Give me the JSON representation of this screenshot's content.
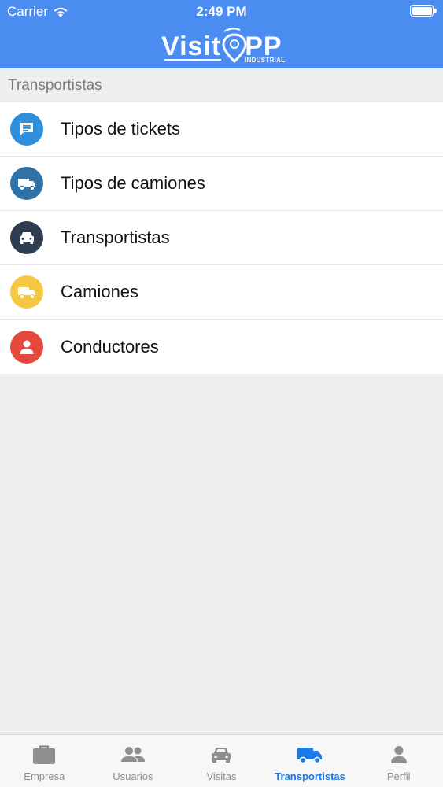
{
  "status_bar": {
    "carrier": "Carrier",
    "time": "2:49 PM"
  },
  "header": {
    "logo_text": "VisitOPP",
    "logo_subtitle": "INDUSTRIAL",
    "background_color": "#4a8cf0"
  },
  "section": {
    "title": "Transportistas"
  },
  "menu": {
    "items": [
      {
        "label": "Tipos de tickets",
        "icon": "message-icon",
        "color": "#2f8fdc"
      },
      {
        "label": "Tipos de camiones",
        "icon": "truck-icon",
        "color": "#2f72a8"
      },
      {
        "label": "Transportistas",
        "icon": "car-icon",
        "color": "#2e3d4f"
      },
      {
        "label": "Camiones",
        "icon": "truck-icon",
        "color": "#f5c842"
      },
      {
        "label": "Conductores",
        "icon": "person-icon",
        "color": "#e5483c"
      }
    ]
  },
  "tabbar": {
    "tabs": [
      {
        "label": "Empresa",
        "icon": "briefcase-icon"
      },
      {
        "label": "Usuarios",
        "icon": "users-icon"
      },
      {
        "label": "Visitas",
        "icon": "car-icon"
      },
      {
        "label": "Transportistas",
        "icon": "truck-icon",
        "active": true
      },
      {
        "label": "Perfil",
        "icon": "person-icon"
      }
    ],
    "active_color": "#1b7ae3",
    "inactive_color": "#8e8e8e"
  }
}
